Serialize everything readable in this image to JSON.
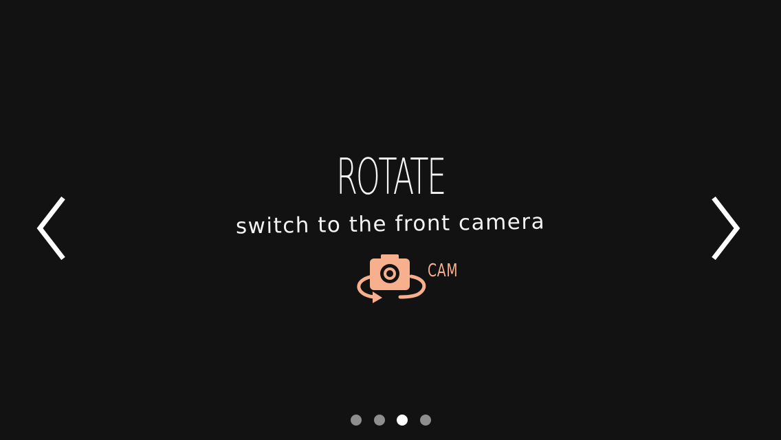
{
  "slide": {
    "title": "ROTATE",
    "subtitle": "switch to the front camera",
    "badge_label": "CAM",
    "icon": "rotate-camera-icon"
  },
  "navigation": {
    "prev_icon": "chevron-left-icon",
    "next_icon": "chevron-right-icon"
  },
  "pagination": {
    "total": 4,
    "current": 3
  },
  "colors": {
    "background": "#121212",
    "text": "#f4f4f4",
    "accent": "#f7b08e",
    "dot_inactive": "#8e8e8e",
    "dot_active": "#ffffff"
  }
}
